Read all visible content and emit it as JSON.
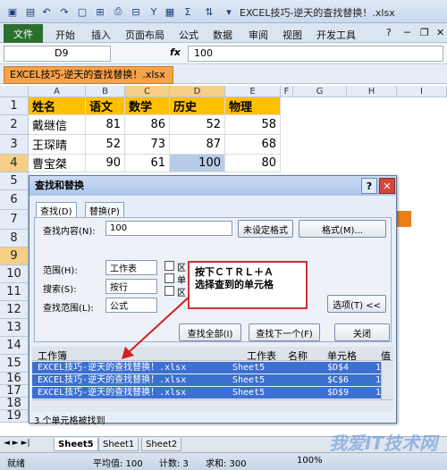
{
  "title_bar": {
    "title": "EXCEL技巧-逆天的查找替换！.xlsx"
  },
  "ribbon": {
    "tabs": [
      "文件",
      "开始",
      "插入",
      "页面布局",
      "公式",
      "数据",
      "审阅",
      "视图",
      "开发工具"
    ]
  },
  "formula_bar": {
    "name_box": "D9",
    "fx": "fx",
    "value": "100"
  },
  "workbook_tab": "EXCEL技巧-逆天的查找替换！.xlsx",
  "columns": [
    "A",
    "B",
    "C",
    "D",
    "E",
    "F",
    "G",
    "H",
    "I"
  ],
  "rows": [
    "1",
    "2",
    "3",
    "4",
    "5",
    "6",
    "7",
    "8",
    "9",
    "10",
    "11",
    "12",
    "13",
    "14",
    "15",
    "16",
    "17",
    "18",
    "19"
  ],
  "table": {
    "headers": [
      "姓名",
      "语文",
      "数学",
      "历史",
      "物理"
    ],
    "rows": [
      [
        "戴继信",
        "81",
        "86",
        "52",
        "58"
      ],
      [
        "王琛晴",
        "52",
        "73",
        "87",
        "68"
      ],
      [
        "曹宝桀",
        "90",
        "61",
        "100",
        "80"
      ]
    ]
  },
  "dialog": {
    "title": "查找和替换",
    "tabs": [
      "查找(D)",
      "替换(P)"
    ],
    "find_label": "查找内容(N):",
    "find_value": "100",
    "no_format": "未设定格式",
    "format_btn": "格式(M)...",
    "scope_label": "范围(H):",
    "scope_value": "工作表",
    "search_label": "搜索(S):",
    "search_value": "按行",
    "lookin_label": "查找范围(L):",
    "lookin_value": "公式",
    "chk1": "区",
    "chk2": "单",
    "chk3": "区",
    "options_btn": "选项(T) <<",
    "find_all": "查找全部(I)",
    "find_next": "查找下一个(F)",
    "close": "关闭",
    "result_headers": [
      "工作簿",
      "工作表",
      "名称",
      "单元格",
      "值"
    ],
    "results": [
      [
        "EXCEL技巧-逆天的查找替换！.xlsx",
        "Sheet5",
        "$D$4",
        "1"
      ],
      [
        "EXCEL技巧-逆天的查找替换！.xlsx",
        "Sheet5",
        "$C$6",
        "1"
      ],
      [
        "EXCEL技巧-逆天的查找替换！.xlsx",
        "Sheet5",
        "$D$9",
        "1"
      ]
    ],
    "status": "3 个单元格被找到"
  },
  "annotation": {
    "line1": "按下ＣＴＲＬ＋Ａ",
    "line2": "选择查到的单元格"
  },
  "sheet_tabs": [
    "Sheet5",
    "Sheet1",
    "Sheet2"
  ],
  "status_bar": {
    "ready": "就绪",
    "avg": "平均值: 100",
    "count": "计数: 3",
    "sum": "求和: 300",
    "zoom": "100%"
  },
  "watermark": "我爱IT技术网"
}
